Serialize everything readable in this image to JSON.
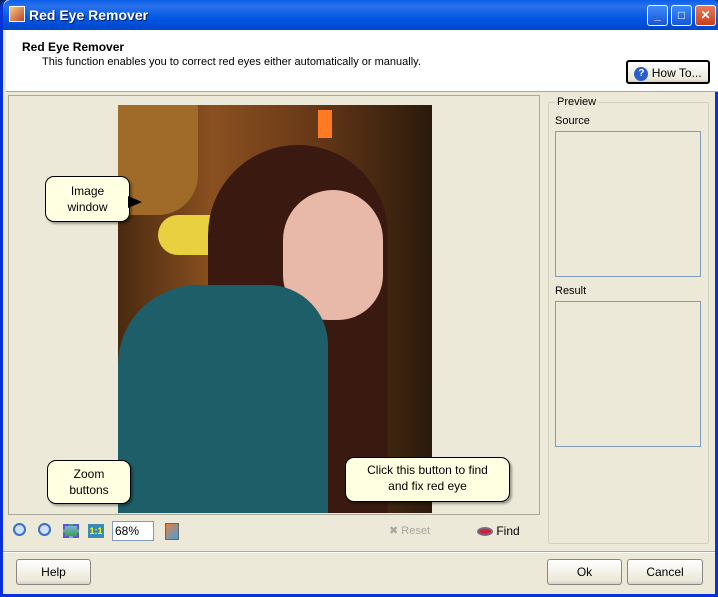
{
  "window": {
    "title": "Red Eye Remover",
    "accent": "#0058e6"
  },
  "header": {
    "title": "Red Eye Remover",
    "description": "This function enables you to correct red eyes either automatically or manually.",
    "how_to_label": "How To..."
  },
  "callouts": {
    "image_window": "Image window",
    "zoom_buttons": "Zoom buttons",
    "find": "Click this button to find and fix red eye"
  },
  "toolbar": {
    "zoom_value": "68%",
    "reset_label": "Reset",
    "find_label": "Find"
  },
  "preview": {
    "group_label": "Preview",
    "source_label": "Source",
    "result_label": "Result"
  },
  "footer": {
    "help_label": "Help",
    "ok_label": "Ok",
    "cancel_label": "Cancel"
  }
}
